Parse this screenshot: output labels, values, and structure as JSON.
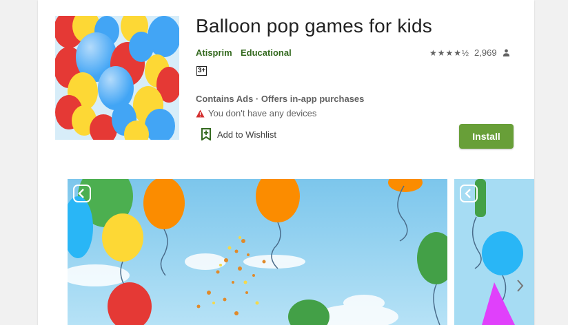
{
  "app": {
    "title": "Balloon pop games for kids",
    "developer": "Atisprim",
    "category": "Educational",
    "rating_stars": "★★★★½",
    "rating_value": 4.5,
    "rating_count": "2,969",
    "age_rating": "3+",
    "ads_text": "Contains Ads · Offers in-app purchases",
    "warning_text": "You don't have any devices",
    "wishlist_label": "Add to Wishlist",
    "install_label": "Install"
  },
  "icons": {
    "rating_person": "person-icon",
    "warning": "warning-triangle-icon",
    "wishlist": "bookmark-plus-icon",
    "screenshot_back": "back-arrow-icon",
    "carousel_next": "chevron-right-icon"
  },
  "colors": {
    "accent": "#33691e",
    "install_button": "#689f38",
    "warning": "#d32f2f",
    "sky": "#8ccfee"
  }
}
